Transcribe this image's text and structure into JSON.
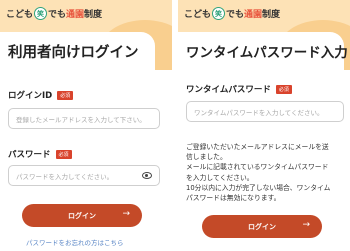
{
  "brand": {
    "pre": "こども",
    "mark": "笑",
    "mid": "でも",
    "accent": "通園",
    "post": "制度"
  },
  "login": {
    "title": "利用者向けログイン",
    "id_label": "ログインID",
    "id_badge": "必須",
    "id_placeholder": "登録したメールアドレスを入力して下さい。",
    "pw_label": "パスワード",
    "pw_badge": "必須",
    "pw_placeholder": "パスワードを入力してください。",
    "button": "ログイン",
    "arrow": "→",
    "footnote": "パスワードをお忘れの方はこちら"
  },
  "otp": {
    "title": "ワンタイムパスワード入力",
    "label": "ワンタイムパスワード",
    "badge": "必須",
    "placeholder": "ワンタイムパスワードを入力してください。",
    "message_lines": [
      "ご登録いただいたメールアドレスにメールを送",
      "信しました。",
      "メールに記載されているワンタイムパスワード",
      "を入力してください。",
      "10分以内に入力が完了しない場合、ワンタイム",
      "パスワードは無効になります。"
    ],
    "button": "ログイン",
    "arrow": "→"
  },
  "colors": {
    "hero": "#fde2b6",
    "accent_button": "#c44a28",
    "badge": "#d9432c",
    "brand_green": "#2fa37c"
  }
}
